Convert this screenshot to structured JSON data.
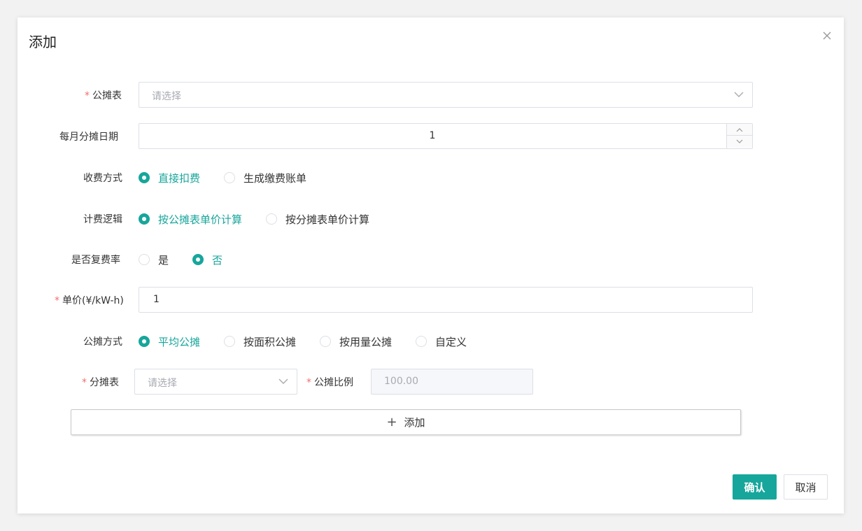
{
  "dialog": {
    "title": "添加"
  },
  "form": {
    "meter": {
      "label": "公摊表",
      "required": "*",
      "placeholder": "请选择"
    },
    "monthly_date": {
      "label": "每月分摊日期",
      "value": "1"
    },
    "charge_method": {
      "label": "收费方式",
      "options": [
        "直接扣费",
        "生成缴费账单"
      ],
      "selected": "直接扣费"
    },
    "billing_logic": {
      "label": "计费逻辑",
      "options": [
        "按公摊表单价计算",
        "按分摊表单价计算"
      ],
      "selected": "按公摊表单价计算"
    },
    "multi_rate": {
      "label": "是否复费率",
      "options": [
        "是",
        "否"
      ],
      "selected": "否"
    },
    "unit_price": {
      "label": "单价(¥/kW-h)",
      "required": "*",
      "value": "1"
    },
    "share_method": {
      "label": "公摊方式",
      "options": [
        "平均公摊",
        "按面积公摊",
        "按用量公摊",
        "自定义"
      ],
      "selected": "平均公摊"
    },
    "sub_meter": {
      "label": "分摊表",
      "required": "*",
      "placeholder": "请选择"
    },
    "share_ratio": {
      "label": "公摊比例",
      "required": "*",
      "value": "100.00"
    },
    "add_button": "添加"
  },
  "footer": {
    "confirm": "确认",
    "cancel": "取消"
  },
  "colors": {
    "accent": "#17a69b",
    "required": "#f56c6c"
  }
}
